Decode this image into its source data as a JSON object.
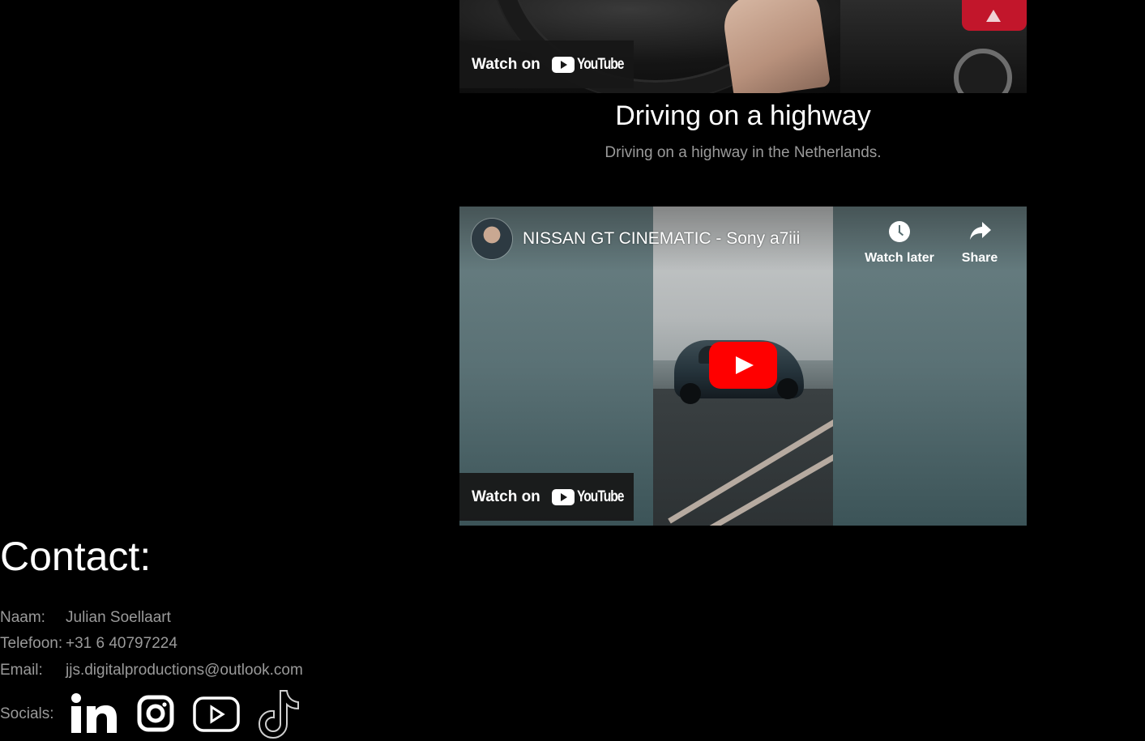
{
  "video1": {
    "watch_on_label": "Watch on",
    "youtube_wordmark": "YouTube",
    "title": "Driving on a highway",
    "description": "Driving on a highway in the Netherlands."
  },
  "video2": {
    "title": "NISSAN GT CINEMATIC - Sony a7iii",
    "watch_later_label": "Watch later",
    "share_label": "Share",
    "watch_on_label": "Watch on",
    "youtube_wordmark": "YouTube"
  },
  "contact": {
    "heading": "Contact:",
    "rows": [
      {
        "label": "Naam:",
        "value": "Julian Soellaart"
      },
      {
        "label": "Telefoon:",
        "value": "+31 6 40797224"
      },
      {
        "label": "Email:",
        "value": "jjs.digitalproductions@outlook.com"
      }
    ],
    "socials_label": "Socials:",
    "socials": [
      "linkedin-icon",
      "instagram-icon",
      "youtube-icon",
      "tiktok-icon"
    ]
  },
  "colors": {
    "background": "#000000",
    "text_primary": "#ffffff",
    "text_secondary": "#9a9a9a",
    "youtube_red": "#ff0000"
  }
}
